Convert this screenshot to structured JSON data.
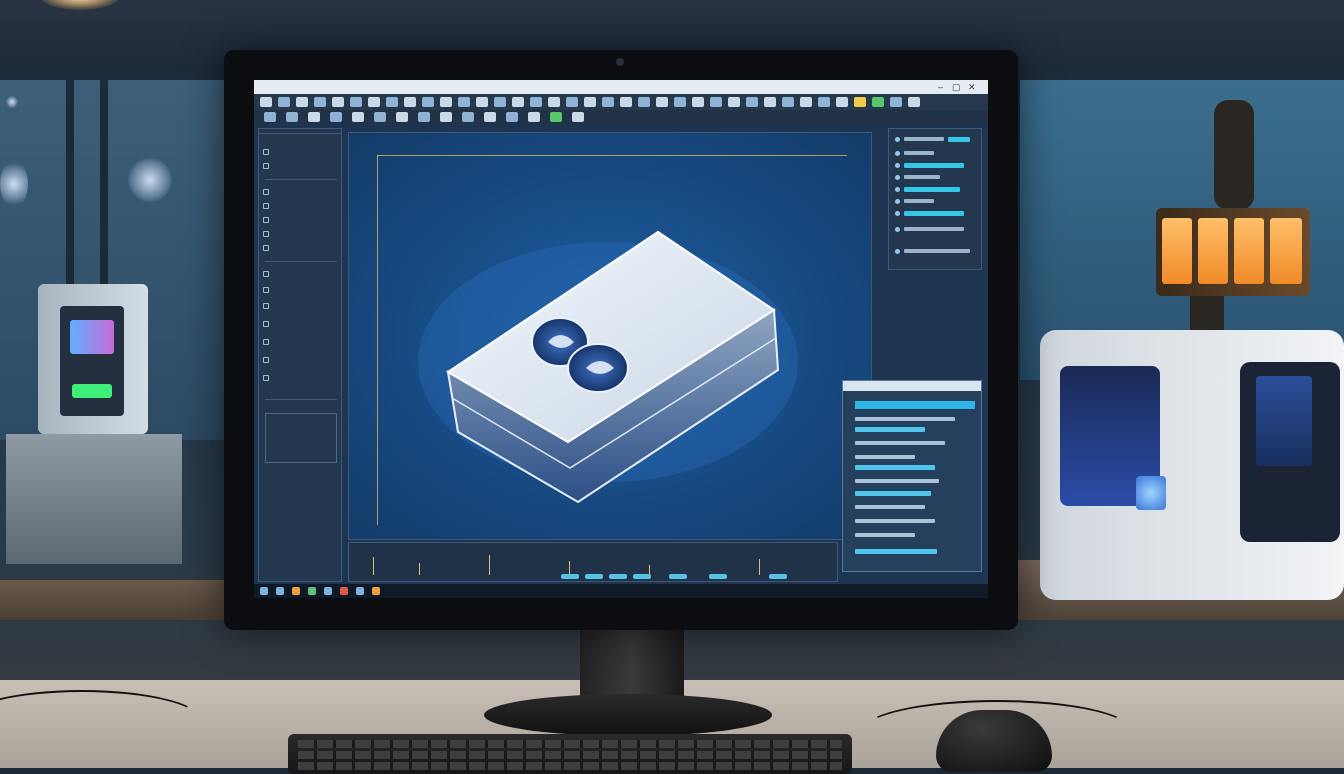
{
  "scene": {
    "description_colors": {
      "screen_bg": "#1d3550",
      "viewport_center": "#1f5fa0",
      "accent_cyan": "#36c6e8",
      "axis_gold": "#d8b65a",
      "lamp_orange": "#f08a28"
    }
  },
  "app": {
    "title_text": "",
    "window_controls": [
      "–",
      "▢",
      "✕"
    ]
  },
  "left_panel": {
    "header": "",
    "items": [
      "",
      "",
      "",
      "",
      "",
      "",
      "",
      "",
      "",
      "",
      "",
      "",
      "",
      ""
    ]
  },
  "right_panel": {
    "rows": 9
  },
  "float_panel": {
    "title": ""
  },
  "icons": {
    "menu": [
      "file-icon",
      "open-icon",
      "save-icon",
      "undo-icon",
      "redo-icon",
      "select-icon",
      "move-icon",
      "rotate-icon",
      "scale-icon",
      "measure-icon"
    ],
    "taskbar": [
      "start-icon",
      "search-icon",
      "folder-icon",
      "browser-icon",
      "cad-icon",
      "settings-icon"
    ]
  }
}
